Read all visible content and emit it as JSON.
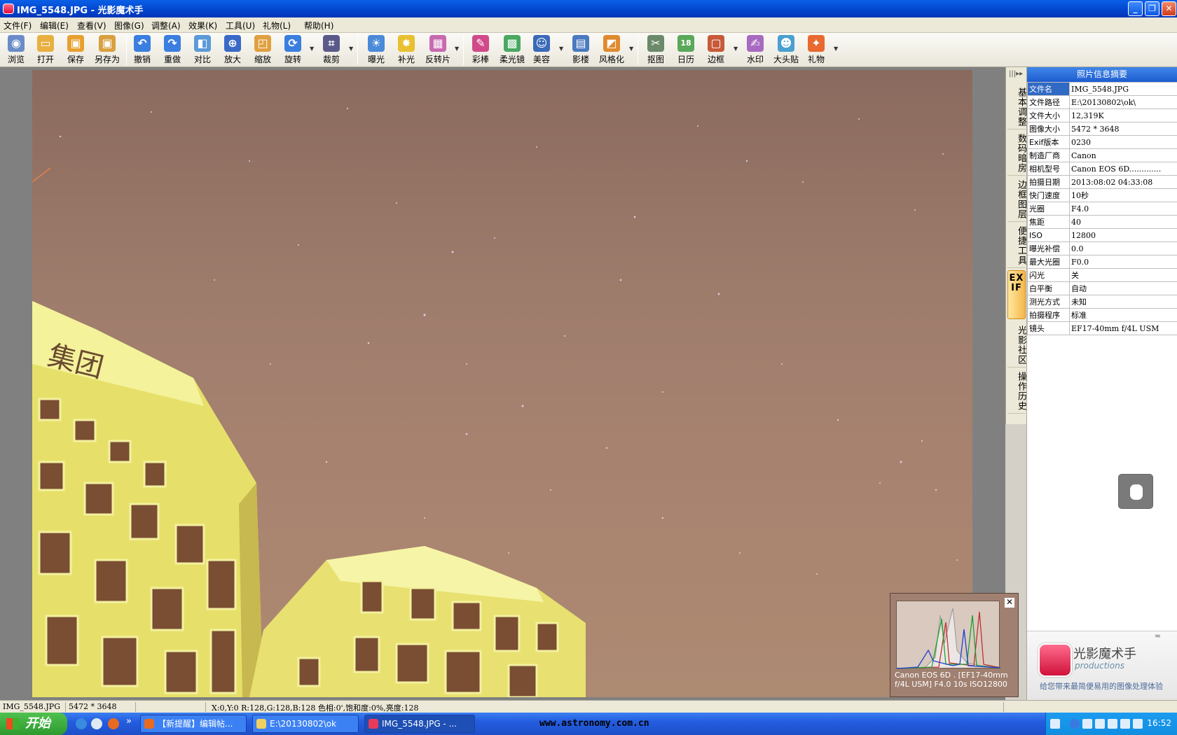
{
  "window": {
    "title": "IMG_5548.JPG - 光影魔术手",
    "min_label": "_",
    "max_label": "❐",
    "close_label": "✕"
  },
  "menu": [
    {
      "label": "文件(F)"
    },
    {
      "label": "编辑(E)"
    },
    {
      "label": "查看(V)"
    },
    {
      "label": "图像(G)"
    },
    {
      "label": "调整(A)"
    },
    {
      "label": "效果(K)"
    },
    {
      "label": "工具(U)"
    },
    {
      "label": "礼物(L)"
    },
    {
      "label": "帮助(H)"
    }
  ],
  "toolbar": [
    {
      "label": "浏览",
      "icon": "eye-icon",
      "color": "#6a8cc8",
      "glyph": "◉"
    },
    {
      "label": "打开",
      "icon": "folder-open-icon",
      "color": "#e8b040",
      "glyph": "▭"
    },
    {
      "label": "保存",
      "icon": "save-icon",
      "color": "#e8a030",
      "glyph": "▣"
    },
    {
      "label": "另存为",
      "icon": "save-as-icon",
      "color": "#d8a040",
      "glyph": "▣"
    },
    {
      "label": "撤销",
      "icon": "undo-icon",
      "color": "#3a7ee0",
      "glyph": "↶"
    },
    {
      "label": "重做",
      "icon": "redo-icon",
      "color": "#3a7ee0",
      "glyph": "↷"
    },
    {
      "label": "对比",
      "icon": "compare-icon",
      "color": "#5a9ad8",
      "glyph": "◧"
    },
    {
      "label": "放大",
      "icon": "zoom-in-icon",
      "color": "#3a6ac8",
      "glyph": "⊕"
    },
    {
      "label": "缩放",
      "icon": "resize-icon",
      "color": "#e0a040",
      "glyph": "◰"
    },
    {
      "label": "旋转",
      "icon": "rotate-icon",
      "color": "#3a7ee0",
      "glyph": "⟳"
    },
    {
      "label": "裁剪",
      "icon": "crop-icon",
      "color": "#5a5a8a",
      "glyph": "⌗"
    },
    {
      "label": "曝光",
      "icon": "exposure-icon",
      "color": "#4a8ad8",
      "glyph": "☀"
    },
    {
      "label": "补光",
      "icon": "fill-light-icon",
      "color": "#e8c030",
      "glyph": "✸"
    },
    {
      "label": "反转片",
      "icon": "slide-film-icon",
      "color": "#c86ab0",
      "glyph": "▦"
    },
    {
      "label": "彩棒",
      "icon": "color-wand-icon",
      "color": "#d04a8a",
      "glyph": "✎"
    },
    {
      "label": "柔光镜",
      "icon": "soft-light-icon",
      "color": "#4aa860",
      "glyph": "▩"
    },
    {
      "label": "美容",
      "icon": "beauty-icon",
      "color": "#3a6ab8",
      "glyph": "☺"
    },
    {
      "label": "影楼",
      "icon": "studio-icon",
      "color": "#4a7ac0",
      "glyph": "▤"
    },
    {
      "label": "风格化",
      "icon": "stylize-icon",
      "color": "#e08a30",
      "glyph": "◩"
    },
    {
      "label": "抠图",
      "icon": "cutout-icon",
      "color": "#6a8a6a",
      "glyph": "✂"
    },
    {
      "label": "日历",
      "icon": "calendar-icon",
      "color": "#5aa85a",
      "glyph": "18"
    },
    {
      "label": "边框",
      "icon": "frame-icon",
      "color": "#c85a3a",
      "glyph": "▢"
    },
    {
      "label": "水印",
      "icon": "watermark-icon",
      "color": "#a86ac0",
      "glyph": "✍"
    },
    {
      "label": "大头贴",
      "icon": "sticker-icon",
      "color": "#4aa0d0",
      "glyph": "☻"
    },
    {
      "label": "礼物",
      "icon": "gift-icon",
      "color": "#e86a30",
      "glyph": "✦"
    }
  ],
  "histogram": {
    "close_label": "✕",
    "caption": "Canon EOS 6D . [EF17-40mm f/4L USM] F4.0 10s ISO12800"
  },
  "sidetabs": [
    {
      "label": "基本调整",
      "active": false
    },
    {
      "label": "数码暗房",
      "active": false
    },
    {
      "label": "边框图层",
      "active": false
    },
    {
      "label": "便捷工具",
      "active": false
    },
    {
      "label": "EXIF",
      "active": true
    },
    {
      "label": "光影社区",
      "active": false
    },
    {
      "label": "操作历史",
      "active": false
    }
  ],
  "sidetabs_grip": "|||▸▸",
  "exif": {
    "title": "照片信息摘要",
    "rows": [
      {
        "key": "文件名",
        "value": "IMG_5548.JPG"
      },
      {
        "key": "文件路径",
        "value": "E:\\20130802\\ok\\"
      },
      {
        "key": "文件大小",
        "value": "12,319K"
      },
      {
        "key": "图像大小",
        "value": "5472 * 3648"
      },
      {
        "key": "Exif版本",
        "value": "0230"
      },
      {
        "key": "制造厂商",
        "value": "Canon"
      },
      {
        "key": "相机型号",
        "value": "Canon EOS 6D............."
      },
      {
        "key": "拍摄日期",
        "value": "2013:08:02 04:33:08"
      },
      {
        "key": "快门速度",
        "value": "10秒"
      },
      {
        "key": "光圈",
        "value": "F4.0"
      },
      {
        "key": "焦距",
        "value": "40"
      },
      {
        "key": "ISO",
        "value": "12800"
      },
      {
        "key": "曝光补偿",
        "value": "0.0"
      },
      {
        "key": "最大光圈",
        "value": "F0.0"
      },
      {
        "key": "闪光",
        "value": "关"
      },
      {
        "key": "白平衡",
        "value": "自动"
      },
      {
        "key": "测光方式",
        "value": "未知"
      },
      {
        "key": "拍摄程序",
        "value": "标准"
      },
      {
        "key": "镜头",
        "value": "EF17-40mm f/4L USM"
      }
    ]
  },
  "brand": {
    "collapse_label": "≈",
    "name": "光影魔术手",
    "sub": "productions",
    "slogan": "给您带来最简便易用的图像处理体验"
  },
  "status": {
    "filename": "IMG_5548.JPG",
    "dimensions": "5472 * 3648",
    "pixel_info": "X:0,Y:0 R:128,G:128,B:128 色相:0',饱和度:0%,亮度:128"
  },
  "taskbar": {
    "start_label": "开始",
    "more_label": "»",
    "tasks": [
      {
        "label": "【新提醒】编辑帖...",
        "active": false
      },
      {
        "label": "E:\\20130802\\ok",
        "active": false
      },
      {
        "label": "IMG_5548.JPG - ...",
        "active": true
      }
    ],
    "watermark": "www.astronomy.com.cn",
    "clock": "16:52"
  }
}
